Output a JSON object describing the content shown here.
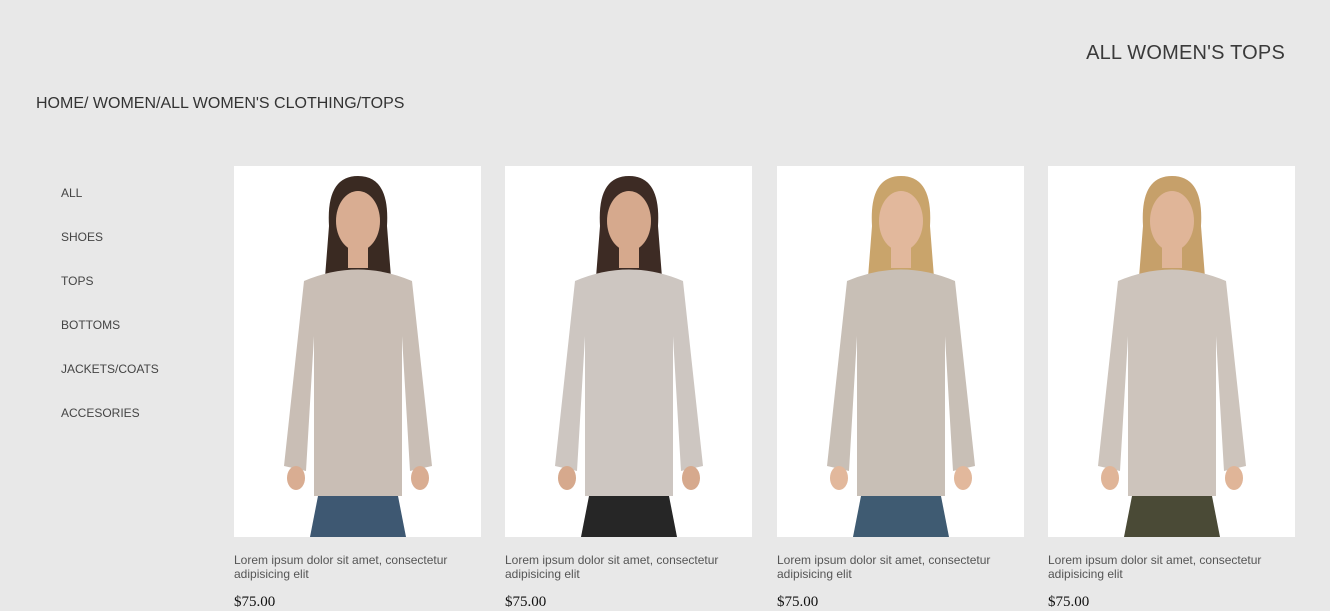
{
  "header": {
    "title": "ALL WOMEN'S TOPS"
  },
  "breadcrumb": {
    "home": "HOME/",
    "women": " WOMEN/",
    "all_clothing": "ALL WOMEN'S CLOTHING/",
    "tops": "TOPS"
  },
  "sidebar": {
    "items": [
      {
        "label": "ALL"
      },
      {
        "label": "SHOES"
      },
      {
        "label": "TOPS"
      },
      {
        "label": "BOTTOMS"
      },
      {
        "label": "JACKETS/COATS"
      },
      {
        "label": "ACCESORIES"
      }
    ]
  },
  "products": [
    {
      "description": "Lorem ipsum dolor sit amet, consectetur adipisicing elit",
      "price": "$75.00",
      "colors": {
        "hair": "#3a2a22",
        "top": "#c9beb5",
        "bottom": "#3e5872",
        "skin": "#d9ad92"
      }
    },
    {
      "description": "Lorem ipsum dolor sit amet, consectetur adipisicing elit",
      "price": "$75.00",
      "colors": {
        "hair": "#3d2b24",
        "top": "#cdc6c1",
        "bottom": "#262626",
        "skin": "#d6a98d"
      }
    },
    {
      "description": "Lorem ipsum dolor sit amet, consectetur adipisicing elit",
      "price": "$75.00",
      "colors": {
        "hair": "#c9a46b",
        "top": "#c8bfb6",
        "bottom": "#3f5b72",
        "skin": "#e2b89c"
      }
    },
    {
      "description": "Lorem ipsum dolor sit amet, consectetur adipisicing elit",
      "price": "$75.00",
      "colors": {
        "hair": "#c6a06a",
        "top": "#cdc4bc",
        "bottom": "#4a4a36",
        "skin": "#e0b598"
      }
    }
  ]
}
